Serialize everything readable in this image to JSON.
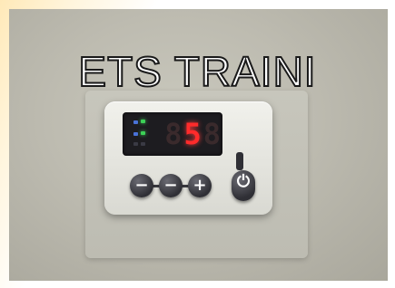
{
  "overlay": {
    "title": "ETS TRAINI"
  },
  "thermostat": {
    "display": {
      "digit_1": "8",
      "digit_2": "5",
      "digit_3": "8"
    },
    "buttons": [
      {
        "symbol": "−"
      },
      {
        "symbol": "−"
      },
      {
        "symbol": "+"
      },
      {
        "symbol": "⏻"
      }
    ]
  },
  "colors": {
    "led_red": "#ff2b2b",
    "led_green": "#3cd056",
    "led_blue": "#4a72d8"
  },
  "icons": [
    "power-icon",
    "minus-icon",
    "plus-icon"
  ]
}
